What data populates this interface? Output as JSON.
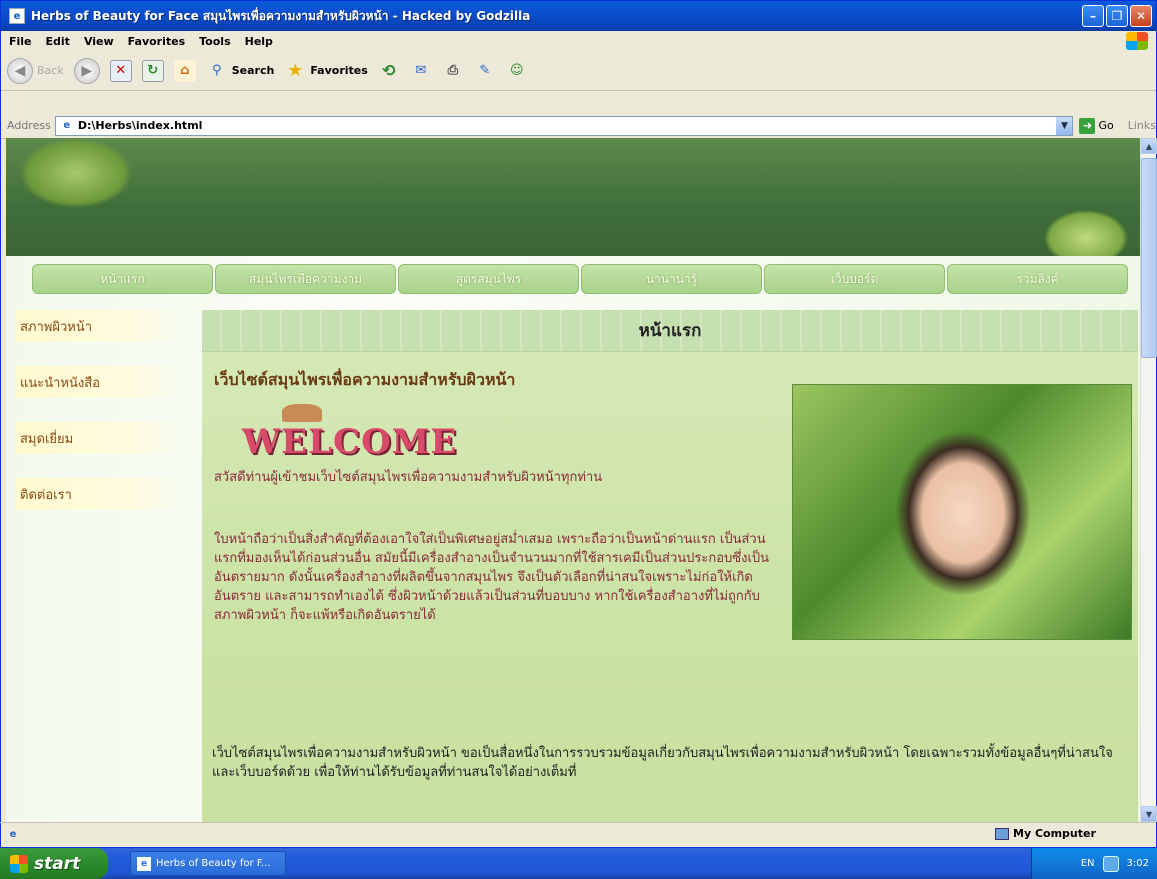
{
  "window": {
    "title": "Herbs of Beauty for Face สมุนไพรเพื่อความงามสำหรับผิวหน้า - Hacked by Godzilla"
  },
  "menubar": {
    "items": [
      "File",
      "Edit",
      "View",
      "Favorites",
      "Tools",
      "Help"
    ]
  },
  "toolbar": {
    "back_label": "Back",
    "search_label": "Search",
    "favorites_label": "Favorites"
  },
  "addressbar": {
    "label": "Address",
    "url": "D:\\Herbs\\index.html",
    "go_label": "Go",
    "links_label": "Links"
  },
  "page": {
    "nav": [
      "หน้าแรก",
      "สมุนไพรเพื่อความงาม",
      "สูตรสมุนไพร",
      "นานาน่ารู้",
      "เว็บบอร์ด",
      "รวมลิงค์"
    ],
    "sidebar": [
      "สภาพผิวหน้า",
      "แนะนำหนังสือ",
      "สมุดเยี่ยม",
      "ติดต่อเรา"
    ],
    "content_title": "หน้าแรก",
    "site_heading": "เว็บไซต์สมุนไพรเพื่อความงามสำหรับผิวหน้า",
    "welcome_graphic": "WELCOME",
    "para1": "สวัสดีท่านผู้เข้าชมเว็บไซต์สมุนไพรเพื่อความงามสำหรับผิวหน้าทุกท่าน",
    "para2": "ใบหน้าถือว่าเป็นสิ่งสำคัญที่ต้องเอาใจใส่เป็นพิเศษอยู่สม่ำเสมอ เพราะถือว่าเป็นหน้าด่านแรก เป็นส่วนแรกที่มองเห็นได้ก่อนส่วนอื่น สมัยนี้มีเครื่องสำอางเป็นจำนวนมากที่ใช้สารเคมีเป็นส่วนประกอบซึ่งเป็นอันตรายมาก ดังนั้นเครื่องสำอางที่ผลิตขึ้นจากสมุนไพร จึงเป็นตัวเลือกที่น่าสนใจเพราะไม่ก่อให้เกิดอันตราย และสามารถทำเองได้ ซึ่งผิวหน้าด้วยแล้วเป็นส่วนที่บอบบาง หากใช้เครื่องสำอางที่ไม่ถูกกับสภาพผิวหน้า ก็จะแพ้หรือเกิดอันตรายได้",
    "para3": "เว็บไซต์สมุนไพรเพื่อความงามสำหรับผิวหน้า ขอเป็นสื่อหนึ่งในการรวบรวมข้อมูลเกี่ยวกับสมุนไพรเพื่อความงามสำหรับผิวหน้า โดยเฉพาะรวมทั้งข้อมูลอื่นๆที่น่าสนใจและเว็บบอร์ดด้วย เพื่อให้ท่านได้รับข้อมูลที่ท่านสนใจได้อย่างเต็มที่"
  },
  "statusbar": {
    "zone": "My Computer"
  },
  "taskbar": {
    "start_label": "start",
    "task_label": "Herbs of Beauty for F...",
    "lang": "EN",
    "clock": "3:02"
  },
  "colors": {
    "sidebar_text": "#8b4a12",
    "body_text": "#8a2a3a",
    "content_bg": "#cde4a8"
  }
}
